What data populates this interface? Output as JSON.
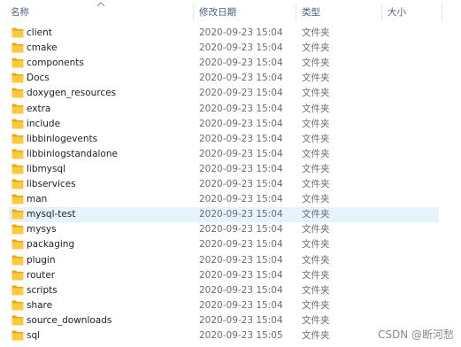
{
  "columns": {
    "name": "名称",
    "date_modified": "修改日期",
    "type": "类型",
    "size": "大小"
  },
  "sort": {
    "column": "name",
    "direction": "ascending",
    "icon": "sort-up-icon"
  },
  "colors": {
    "header_text": "#4d6082",
    "folder_yellow": "#ffc83d",
    "folder_dark": "#e8a90f",
    "selected_row": "#e5f3ff"
  },
  "files": [
    {
      "name": "client",
      "date": "2020-09-23 15:04",
      "type": "文件夹",
      "icon": "folder-icon"
    },
    {
      "name": "cmake",
      "date": "2020-09-23 15:04",
      "type": "文件夹",
      "icon": "folder-icon"
    },
    {
      "name": "components",
      "date": "2020-09-23 15:04",
      "type": "文件夹",
      "icon": "folder-icon"
    },
    {
      "name": "Docs",
      "date": "2020-09-23 15:04",
      "type": "文件夹",
      "icon": "folder-icon"
    },
    {
      "name": "doxygen_resources",
      "date": "2020-09-23 15:04",
      "type": "文件夹",
      "icon": "folder-icon"
    },
    {
      "name": "extra",
      "date": "2020-09-23 15:04",
      "type": "文件夹",
      "icon": "folder-icon"
    },
    {
      "name": "include",
      "date": "2020-09-23 15:04",
      "type": "文件夹",
      "icon": "folder-icon"
    },
    {
      "name": "libbinlogevents",
      "date": "2020-09-23 15:04",
      "type": "文件夹",
      "icon": "folder-icon"
    },
    {
      "name": "libbinlogstandalone",
      "date": "2020-09-23 15:04",
      "type": "文件夹",
      "icon": "folder-icon"
    },
    {
      "name": "libmysql",
      "date": "2020-09-23 15:04",
      "type": "文件夹",
      "icon": "folder-icon"
    },
    {
      "name": "libservices",
      "date": "2020-09-23 15:04",
      "type": "文件夹",
      "icon": "folder-icon"
    },
    {
      "name": "man",
      "date": "2020-09-23 15:04",
      "type": "文件夹",
      "icon": "folder-icon"
    },
    {
      "name": "mysql-test",
      "date": "2020-09-23 15:04",
      "type": "文件夹",
      "icon": "folder-icon",
      "selected": true
    },
    {
      "name": "mysys",
      "date": "2020-09-23 15:04",
      "type": "文件夹",
      "icon": "folder-icon"
    },
    {
      "name": "packaging",
      "date": "2020-09-23 15:04",
      "type": "文件夹",
      "icon": "folder-icon"
    },
    {
      "name": "plugin",
      "date": "2020-09-23 15:04",
      "type": "文件夹",
      "icon": "folder-icon"
    },
    {
      "name": "router",
      "date": "2020-09-23 15:04",
      "type": "文件夹",
      "icon": "folder-icon"
    },
    {
      "name": "scripts",
      "date": "2020-09-23 15:04",
      "type": "文件夹",
      "icon": "folder-icon"
    },
    {
      "name": "share",
      "date": "2020-09-23 15:04",
      "type": "文件夹",
      "icon": "folder-icon"
    },
    {
      "name": "source_downloads",
      "date": "2020-09-23 15:04",
      "type": "文件夹",
      "icon": "folder-icon"
    },
    {
      "name": "sql",
      "date": "2020-09-23 15:05",
      "type": "文件夹",
      "icon": "folder-icon"
    }
  ],
  "watermark": "CSDN @断河愁"
}
